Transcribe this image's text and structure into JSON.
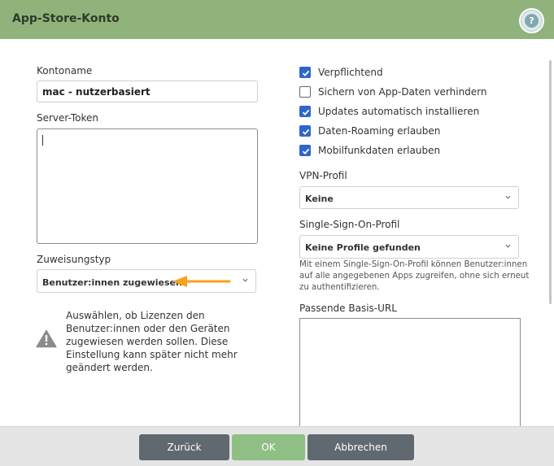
{
  "dialog": {
    "title": "App-Store-Konto",
    "help_label": "?"
  },
  "left": {
    "kontoname_label": "Kontoname",
    "kontoname_value": "mac - nutzerbasiert",
    "server_token_label": "Server-Token",
    "server_token_value": "",
    "zuweisungstyp_label": "Zuweisungstyp",
    "zuweisungstyp_value": "Benutzer:innen zugewiesen",
    "warning_text": "Auswählen, ob Lizenzen den Benutzer:innen oder den Geräten zugewiesen werden sollen. Diese Einstellung kann später nicht mehr geändert werden."
  },
  "right": {
    "checkboxes": [
      {
        "label": "Verpflichtend",
        "checked": true
      },
      {
        "label": "Sichern von App-Daten verhindern",
        "checked": false
      },
      {
        "label": "Updates automatisch installieren",
        "checked": true
      },
      {
        "label": "Daten-Roaming erlauben",
        "checked": true
      },
      {
        "label": "Mobilfunkdaten erlauben",
        "checked": true
      }
    ],
    "vpn_label": "VPN-Profil",
    "vpn_value": "Keine",
    "sso_label": "Single-Sign-On-Profil",
    "sso_value": "Keine Profile gefunden",
    "sso_help": "Mit einem Single-Sign-On-Profil können Benutzer:innen auf alle angegebenen Apps zugreifen, ohne sich erneut zu authentifizieren.",
    "basis_url_label": "Passende Basis-URL",
    "basis_url_value": ""
  },
  "footer": {
    "back_label": "Zurück",
    "ok_label": "OK",
    "cancel_label": "Abbrechen"
  },
  "colors": {
    "title_bar": "#8fb37b",
    "checkbox_checked": "#2f66cc",
    "ok_button": "#8fbf85",
    "secondary_button": "#606870",
    "arrow": "#f7a21b"
  },
  "icons": [
    "help-icon",
    "checkmark-icon",
    "chevron-down-icon",
    "warning-icon",
    "arrow-left-icon"
  ]
}
